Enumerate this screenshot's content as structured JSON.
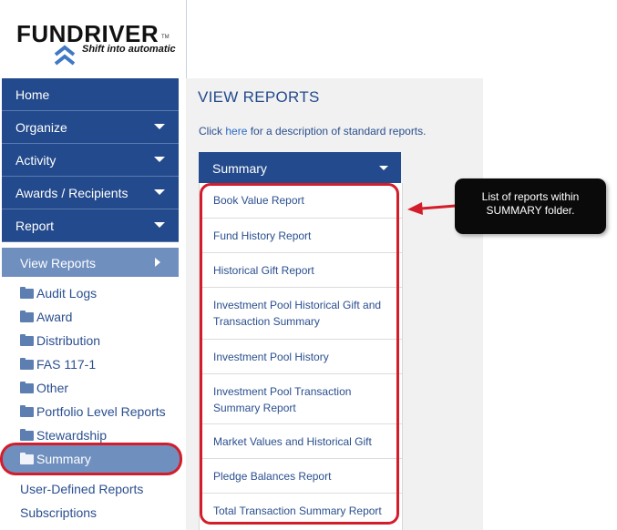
{
  "logo": {
    "brand": "FUNDRIVER",
    "tm": "TM",
    "tagline": "Shift into automatic"
  },
  "nav": {
    "items": [
      {
        "label": "Home",
        "has_caret": false
      },
      {
        "label": "Organize",
        "has_caret": true
      },
      {
        "label": "Activity",
        "has_caret": true
      },
      {
        "label": "Awards / Recipients",
        "has_caret": true
      },
      {
        "label": "Report",
        "has_caret": true
      }
    ],
    "sub_header": "View Reports",
    "folders": [
      "Audit Logs",
      "Award",
      "Distribution",
      "FAS 117-1",
      "Other",
      "Portfolio Level Reports",
      "Stewardship"
    ],
    "selected_folder": "Summary",
    "links": [
      "User-Defined Reports",
      "Subscriptions"
    ]
  },
  "main": {
    "title": "VIEW REPORTS",
    "desc_prefix": "Click ",
    "desc_link": "here",
    "desc_suffix": " for a description of standard reports.",
    "dropdown_value": "Summary",
    "reports": [
      "Book Value Report",
      "Fund History Report",
      "Historical Gift Report",
      "Investment Pool Historical Gift and Transaction Summary",
      "Investment Pool History",
      "Investment Pool Transaction Summary Report",
      "Market Values and Historical Gift",
      "Pledge Balances Report",
      "Total Transaction Summary Report"
    ]
  },
  "callout": {
    "text": "List of reports within SUMMARY folder."
  },
  "colors": {
    "nav_bg": "#234a8c",
    "sub_bg": "#6f8fbf",
    "highlight": "#d31d2a",
    "link": "#2a4f8f"
  }
}
